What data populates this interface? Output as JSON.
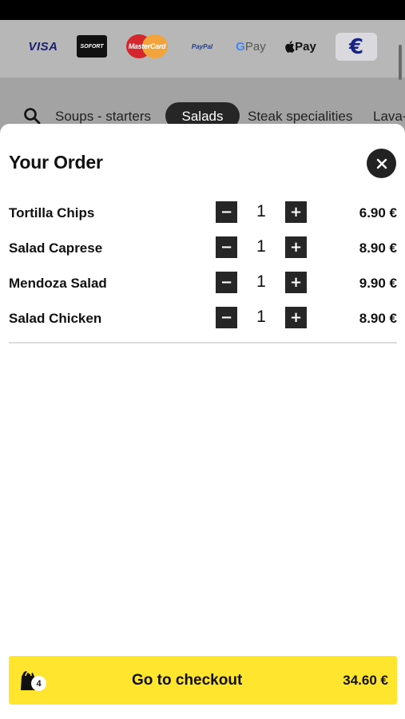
{
  "payment_methods": {
    "visa": "VISA",
    "sofort": "SOFORT",
    "mastercard": "MasterCard",
    "paypal": "PayPal",
    "gpay": "Pay",
    "gpay_g": "G",
    "applepay": "Pay",
    "currency": "€"
  },
  "categories": {
    "items": [
      "Soups - starters",
      "Salads",
      "Steak specialities",
      "Lava-"
    ],
    "active": "Salads"
  },
  "order": {
    "title": "Your Order",
    "items": [
      {
        "name": "Tortilla Chips",
        "qty": "1",
        "price": "6.90 €"
      },
      {
        "name": "Salad Caprese",
        "qty": "1",
        "price": "8.90 €"
      },
      {
        "name": "Mendoza Salad",
        "qty": "1",
        "price": "9.90 €"
      },
      {
        "name": "Salad Chicken",
        "qty": "1",
        "price": "8.90 €"
      }
    ],
    "minus_symbol": "−",
    "plus_symbol": "+"
  },
  "checkout": {
    "label": "Go to checkout",
    "total": "34.60 €",
    "bag_count": "4"
  },
  "colors": {
    "accent": "#ffe52e",
    "dark": "#262626"
  }
}
